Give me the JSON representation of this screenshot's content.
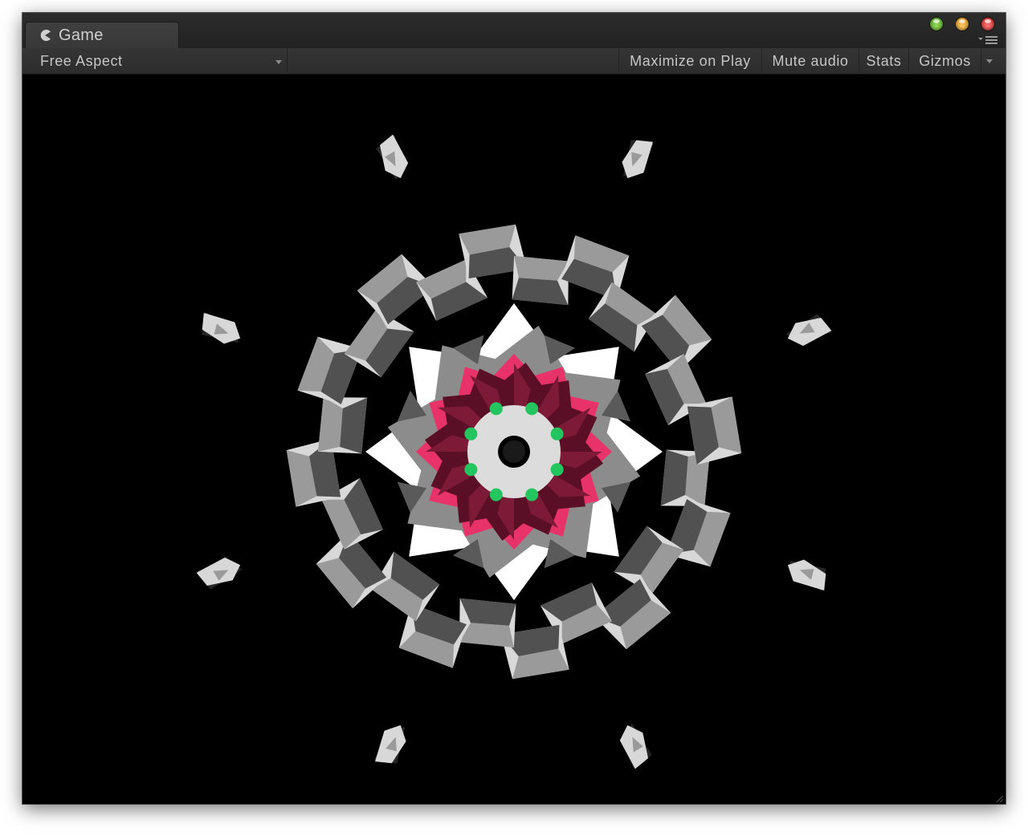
{
  "window": {
    "tab_title": "Game",
    "tab_icon": "pacman-game-icon",
    "controls": [
      "green-zoom-button",
      "yellow-minimize-button",
      "red-close-button"
    ]
  },
  "toolbar": {
    "aspect_label": "Free Aspect",
    "maximize_label": "Maximize on Play",
    "mute_label": "Mute audio",
    "stats_label": "Stats",
    "gizmos_label": "Gizmos"
  },
  "scene": {
    "background": "#000000",
    "colors": {
      "cube_light": "#d8d8d8",
      "cube_mid": "#9a9a9a",
      "cube_dark": "#3a3a3a",
      "star_white": "#ffffff",
      "star_grey": "#8c8c8c",
      "crimson_dark": "#5a0f26",
      "crimson_mid": "#7d1a37",
      "pink": "#e8336a",
      "green_dot": "#22c55e",
      "center_ring": "#dcdcdc"
    }
  }
}
